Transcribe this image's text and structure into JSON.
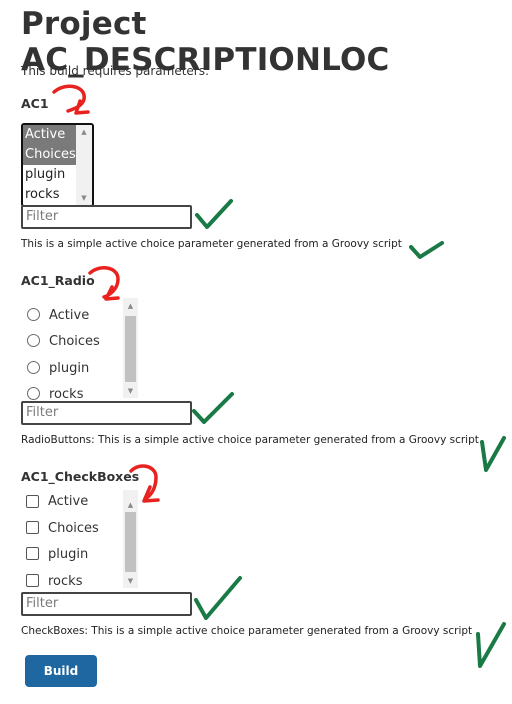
{
  "page": {
    "title": "Project AC_DESCRIPTIONLOC",
    "intro": "This build requires parameters:"
  },
  "params": [
    {
      "name": "AC1",
      "type": "multi-select",
      "options": [
        "Active",
        "Choices",
        "plugin",
        "rocks"
      ],
      "selected": [
        "Active",
        "Choices"
      ],
      "filter_placeholder": "Filter",
      "description": "This is a simple active choice parameter generated from a Groovy script"
    },
    {
      "name": "AC1_Radio",
      "type": "radio",
      "options": [
        "Active",
        "Choices",
        "plugin",
        "rocks"
      ],
      "filter_placeholder": "Filter",
      "description": "RadioButtons: This is a simple active choice parameter generated from a Groovy script"
    },
    {
      "name": "AC1_CheckBoxes",
      "type": "checkbox",
      "options": [
        "Active",
        "Choices",
        "plugin",
        "rocks"
      ],
      "filter_placeholder": "Filter",
      "description": "CheckBoxes: This is a simple active choice parameter generated from a Groovy script"
    }
  ],
  "build_button": {
    "label": "Build",
    "color": "#1e67a0"
  },
  "annotations": {
    "red_arrow_color": "#e8221e",
    "green_check_color": "#1a7a45"
  }
}
